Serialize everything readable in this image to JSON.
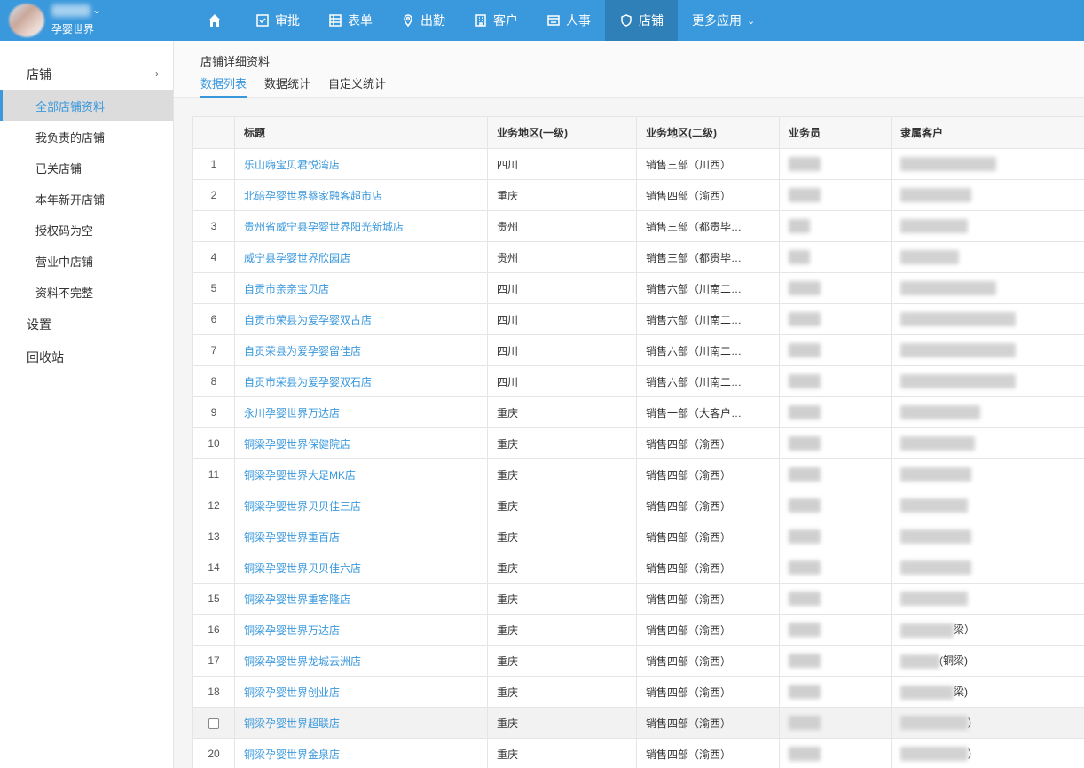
{
  "brand": {
    "subtitle": "孕婴世界"
  },
  "nav": [
    {
      "label": "审批",
      "icon": "approval-icon"
    },
    {
      "label": "表单",
      "icon": "table-icon"
    },
    {
      "label": "出勤",
      "icon": "location-pin-icon"
    },
    {
      "label": "客户",
      "icon": "building-icon"
    },
    {
      "label": "人事",
      "icon": "id-card-icon"
    },
    {
      "label": "店铺",
      "icon": "shield-icon"
    },
    {
      "label": "更多应用",
      "icon": "chevron-down-icon"
    }
  ],
  "sidebar": {
    "group_label": "店铺",
    "items": [
      "全部店铺资料",
      "我负责的店铺",
      "已关店铺",
      "本年新开店铺",
      "授权码为空",
      "营业中店铺",
      "资料不完整"
    ],
    "settings": "设置",
    "recycle": "回收站"
  },
  "page": {
    "title": "店铺详细资料",
    "tabs": [
      "数据列表",
      "数据统计",
      "自定义统计"
    ]
  },
  "table": {
    "headers": [
      "",
      "标题",
      "业务地区(一级)",
      "业务地区(二级)",
      "业务员",
      "隶属客户"
    ],
    "rows": [
      {
        "idx": "1",
        "title": "乐山嗨宝贝君悦湾店",
        "region1": "四川",
        "region2": "销售三部（川西）",
        "cust_suffix": ""
      },
      {
        "idx": "2",
        "title": "北碚孕婴世界蔡家融客超市店",
        "region1": "重庆",
        "region2": "销售四部（渝西）",
        "cust_suffix": ""
      },
      {
        "idx": "3",
        "title": "贵州省威宁县孕婴世界阳光新城店",
        "region1": "贵州",
        "region2": "销售三部（都贵毕…",
        "cust_suffix": ""
      },
      {
        "idx": "4",
        "title": "威宁县孕婴世界欣园店",
        "region1": "贵州",
        "region2": "销售三部（都贵毕…",
        "cust_suffix": ""
      },
      {
        "idx": "5",
        "title": "自贡市亲亲宝贝店",
        "region1": "四川",
        "region2": "销售六部（川南二…",
        "cust_suffix": ""
      },
      {
        "idx": "6",
        "title": "自贡市荣县为爱孕婴双古店",
        "region1": "四川",
        "region2": "销售六部（川南二…",
        "cust_suffix": ""
      },
      {
        "idx": "7",
        "title": "自贡荣县为爱孕婴留佳店",
        "region1": "四川",
        "region2": "销售六部（川南二…",
        "cust_suffix": ""
      },
      {
        "idx": "8",
        "title": "自贡市荣县为爱孕婴双石店",
        "region1": "四川",
        "region2": "销售六部（川南二…",
        "cust_suffix": ""
      },
      {
        "idx": "9",
        "title": "永川孕婴世界万达店",
        "region1": "重庆",
        "region2": "销售一部（大客户…",
        "cust_suffix": ""
      },
      {
        "idx": "10",
        "title": "铜梁孕婴世界保健院店",
        "region1": "重庆",
        "region2": "销售四部（渝西）",
        "cust_suffix": ""
      },
      {
        "idx": "11",
        "title": "铜梁孕婴世界大足MK店",
        "region1": "重庆",
        "region2": "销售四部（渝西）",
        "cust_suffix": ""
      },
      {
        "idx": "12",
        "title": "铜梁孕婴世界贝贝佳三店",
        "region1": "重庆",
        "region2": "销售四部（渝西）",
        "cust_suffix": ""
      },
      {
        "idx": "13",
        "title": "铜梁孕婴世界重百店",
        "region1": "重庆",
        "region2": "销售四部（渝西）",
        "cust_suffix": ""
      },
      {
        "idx": "14",
        "title": "铜梁孕婴世界贝贝佳六店",
        "region1": "重庆",
        "region2": "销售四部（渝西）",
        "cust_suffix": ""
      },
      {
        "idx": "15",
        "title": "铜梁孕婴世界重客隆店",
        "region1": "重庆",
        "region2": "销售四部（渝西）",
        "cust_suffix": ""
      },
      {
        "idx": "16",
        "title": "铜梁孕婴世界万达店",
        "region1": "重庆",
        "region2": "销售四部（渝西）",
        "cust_suffix": "梁）"
      },
      {
        "idx": "17",
        "title": "铜梁孕婴世界龙城云洲店",
        "region1": "重庆",
        "region2": "销售四部（渝西）",
        "cust_suffix": "(铜梁)"
      },
      {
        "idx": "18",
        "title": "铜梁孕婴世界创业店",
        "region1": "重庆",
        "region2": "销售四部（渝西）",
        "cust_suffix": "梁)"
      },
      {
        "idx": "",
        "title": "铜梁孕婴世界超联店",
        "region1": "重庆",
        "region2": "销售四部（渝西）",
        "cust_suffix": ")"
      },
      {
        "idx": "20",
        "title": "铜梁孕婴世界金泉店",
        "region1": "重庆",
        "region2": "销售四部（渝西）",
        "cust_suffix": ")"
      }
    ]
  }
}
